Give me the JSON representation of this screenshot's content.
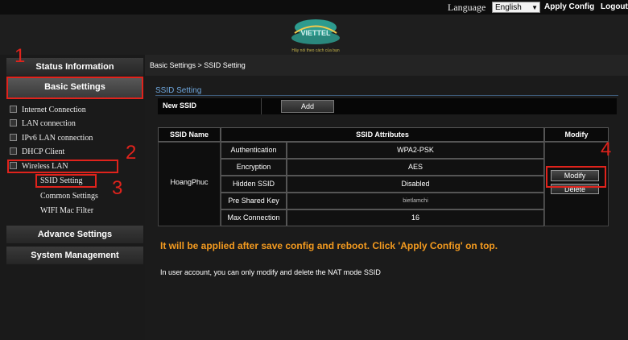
{
  "topbar": {
    "language_label": "Language",
    "language_value": "English",
    "apply_config": "Apply Config",
    "logout": "Logout"
  },
  "header": {
    "logo_text": "VIETTEL",
    "tagline": "Hãy nói theo cách của bạn"
  },
  "sidebar": {
    "status_information": "Status Information",
    "basic_settings": "Basic Settings",
    "items": [
      {
        "label": "Internet Connection"
      },
      {
        "label": "LAN connection"
      },
      {
        "label": "IPv6 LAN connection"
      },
      {
        "label": "DHCP Client"
      },
      {
        "label": "Wireless LAN"
      }
    ],
    "subitems": [
      {
        "label": "SSID Setting"
      },
      {
        "label": "Common Settings"
      },
      {
        "label": "WIFI Mac Filter"
      }
    ],
    "advance_settings": "Advance Settings",
    "system_management": "System Management"
  },
  "annotations": {
    "n1": "1",
    "n2": "2",
    "n3": "3",
    "n4": "4",
    "accent_color": "#e0231c"
  },
  "main": {
    "breadcrumb": "Basic Settings > SSID Setting",
    "section_title": "SSID Setting",
    "new_ssid_label": "New SSID",
    "add_button": "Add",
    "table": {
      "headers": [
        "SSID Name",
        "SSID Attributes",
        "Modify"
      ],
      "ssid_name": "HoangPhuc",
      "attributes": [
        {
          "label": "Authentication",
          "value": "WPA2-PSK"
        },
        {
          "label": "Encryption",
          "value": "AES"
        },
        {
          "label": "Hidden SSID",
          "value": "Disabled"
        },
        {
          "label": "Pre Shared Key",
          "value": "bietlamchi"
        },
        {
          "label": "Max Connection",
          "value": "16"
        }
      ],
      "modify_button": "Modify",
      "delete_button": "Delete"
    },
    "notice": "It will be applied after save config and reboot. Click 'Apply Config' on top.",
    "info": "In user account, you can only modify and delete the NAT mode SSID",
    "notice_color": "#f39a1f",
    "title_color": "#6ea6dc"
  }
}
